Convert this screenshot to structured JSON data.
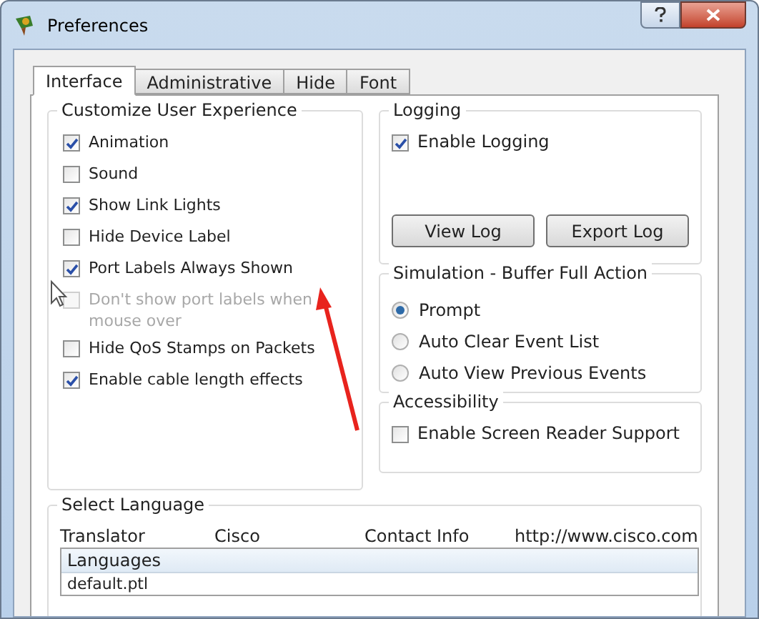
{
  "window": {
    "title": "Preferences"
  },
  "tabs": [
    {
      "label": "Interface",
      "selected": true
    },
    {
      "label": "Administrative",
      "selected": false
    },
    {
      "label": "Hide",
      "selected": false
    },
    {
      "label": "Font",
      "selected": false
    }
  ],
  "customize": {
    "title": "Customize User Experience",
    "options": [
      {
        "label": "Animation",
        "checked": true,
        "disabled": false
      },
      {
        "label": "Sound",
        "checked": false,
        "disabled": false
      },
      {
        "label": "Show Link Lights",
        "checked": true,
        "disabled": false
      },
      {
        "label": "Hide Device Label",
        "checked": false,
        "disabled": false
      },
      {
        "label": "Port Labels Always Shown",
        "checked": true,
        "disabled": false
      },
      {
        "label": "Don't show port labels when mouse over",
        "checked": false,
        "disabled": true
      },
      {
        "label": "Hide QoS Stamps on Packets",
        "checked": false,
        "disabled": false
      },
      {
        "label": "Enable cable length effects",
        "checked": true,
        "disabled": false
      }
    ]
  },
  "logging": {
    "title": "Logging",
    "options": [
      {
        "label": "Enable Logging",
        "checked": true,
        "disabled": false
      }
    ],
    "buttons": [
      "View Log",
      "Export Log"
    ]
  },
  "simulation": {
    "title": "Simulation - Buffer Full Action",
    "options": [
      {
        "label": "Prompt",
        "selected": true
      },
      {
        "label": "Auto Clear Event List",
        "selected": false
      },
      {
        "label": "Auto View Previous Events",
        "selected": false
      }
    ]
  },
  "accessibility": {
    "title": "Accessibility",
    "options": [
      {
        "label": "Enable Screen Reader Support",
        "checked": false,
        "disabled": false
      }
    ]
  },
  "language": {
    "title": "Select Language",
    "info": [
      "Translator",
      "Cisco",
      "Contact Info",
      "http://www.cisco.com"
    ],
    "list": {
      "header": "Languages",
      "rows": [
        "default.ptl"
      ]
    }
  }
}
